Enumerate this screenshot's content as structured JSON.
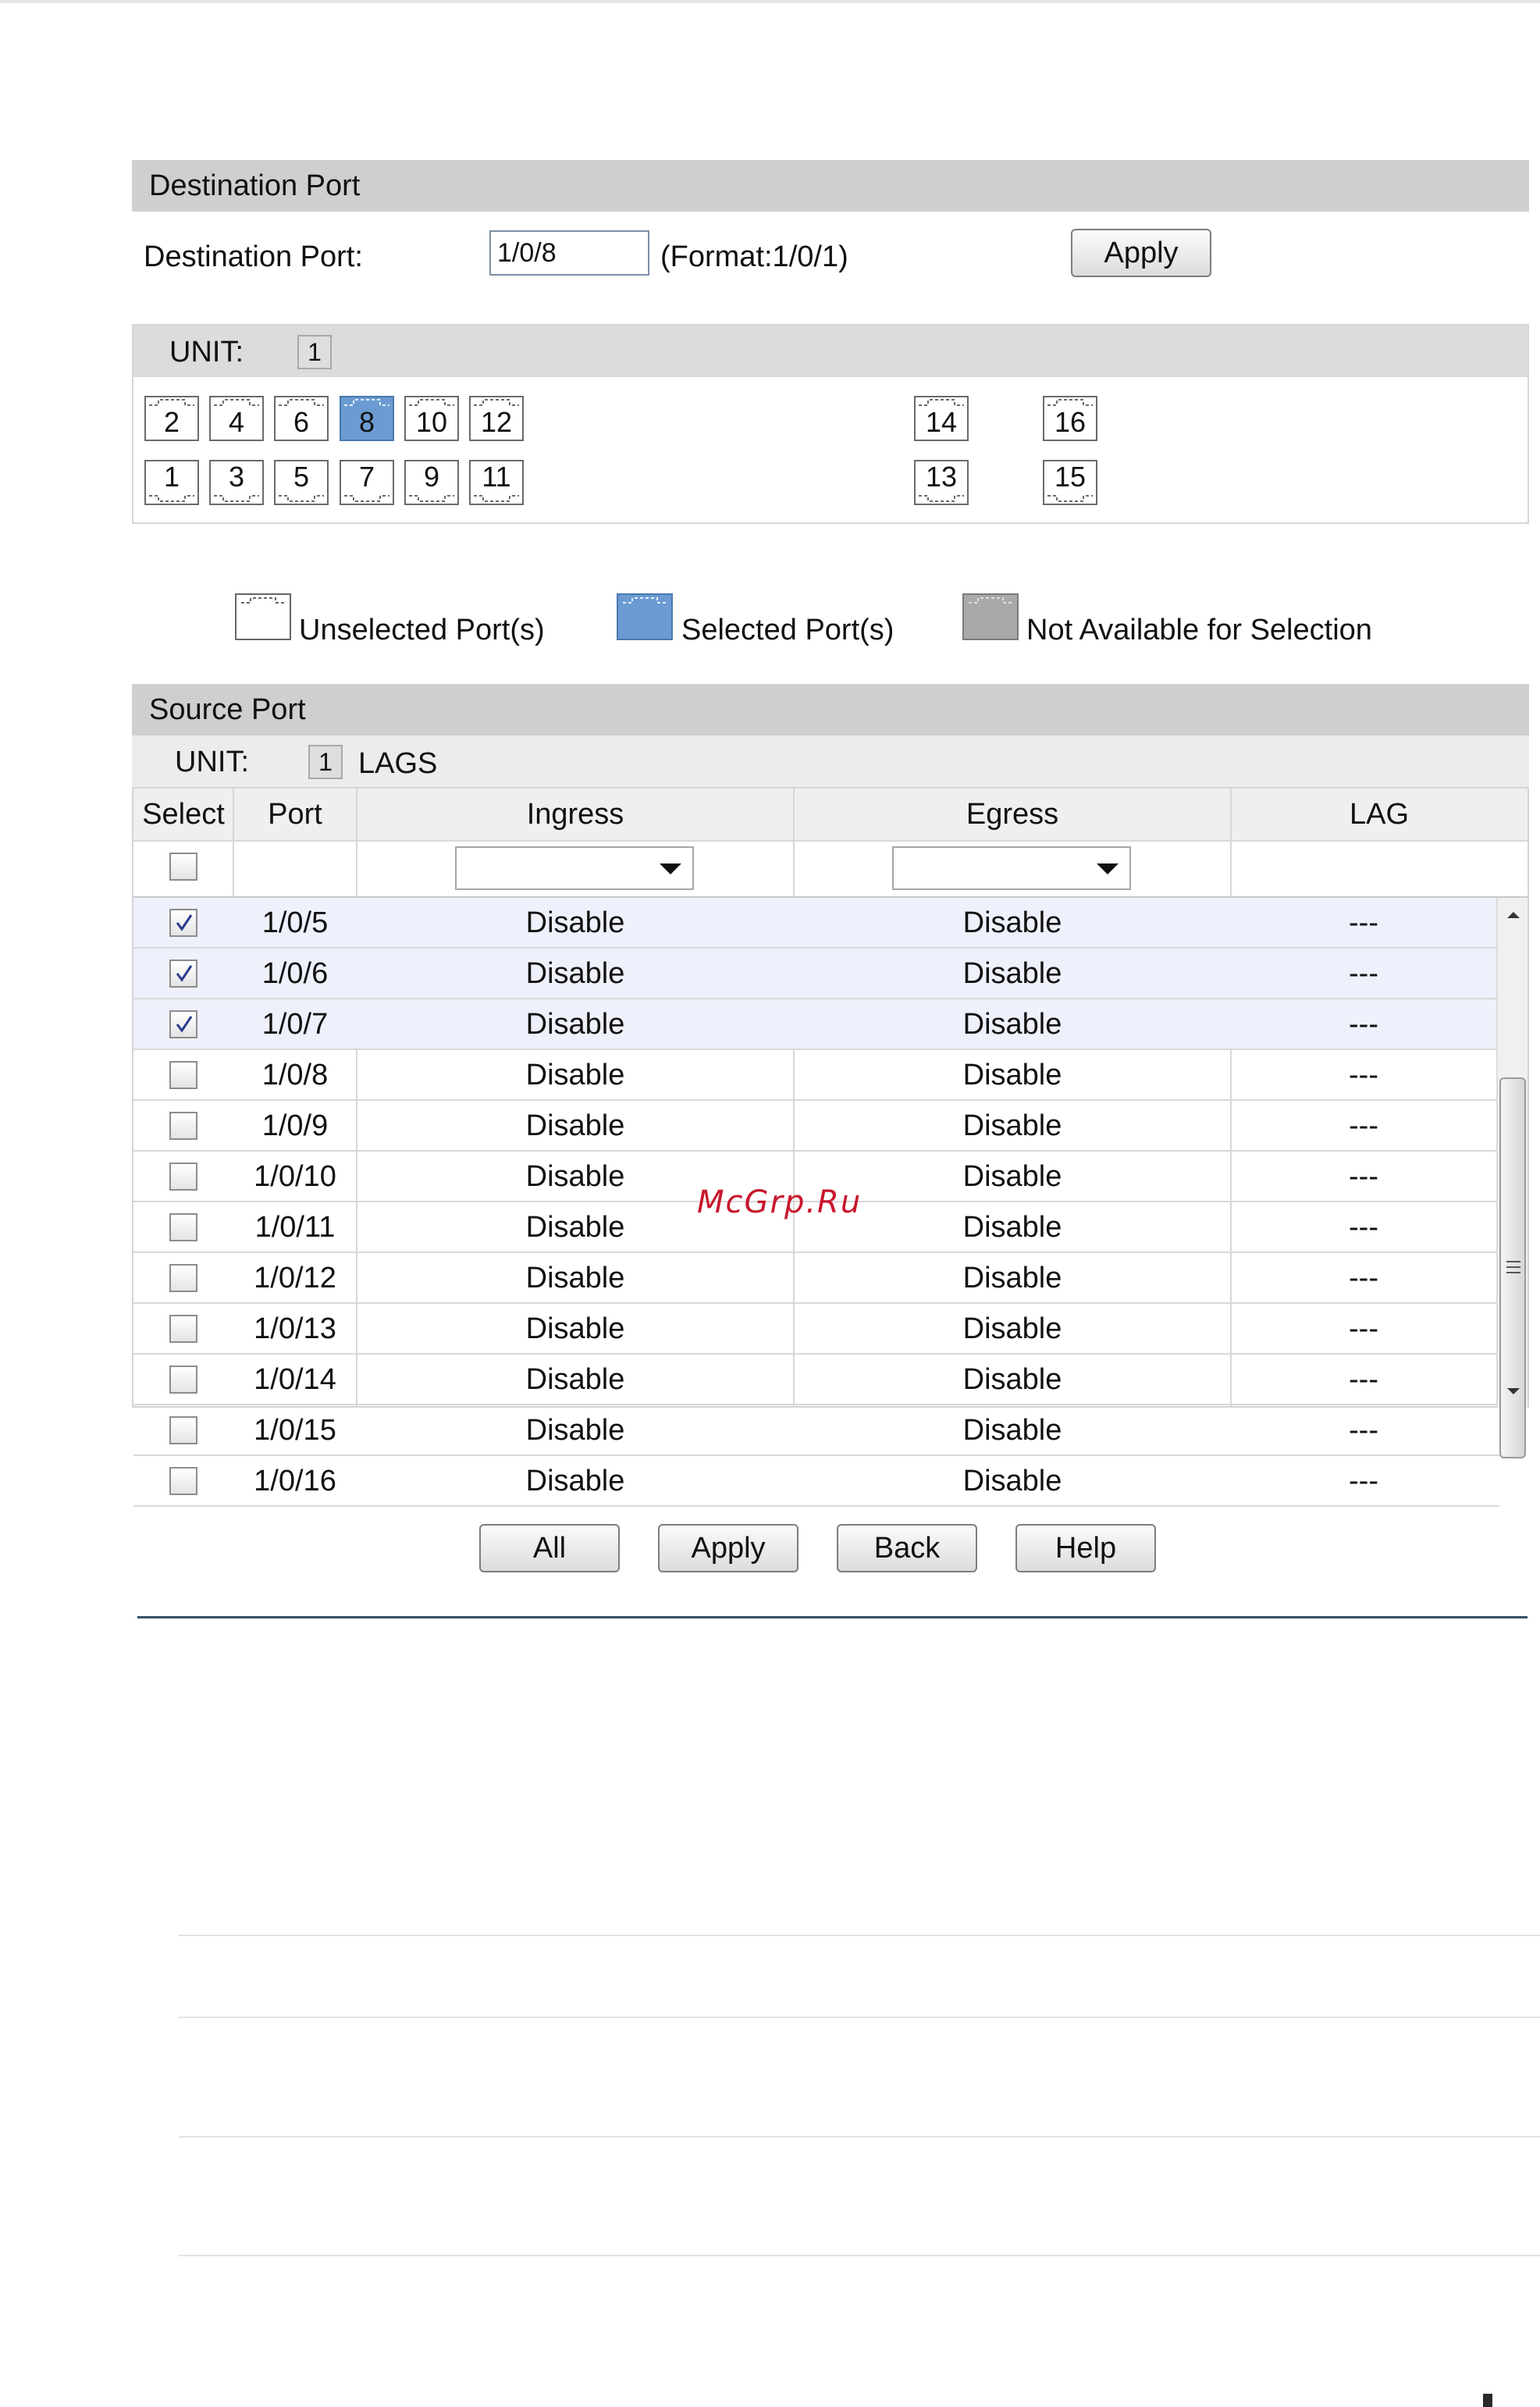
{
  "destination": {
    "section_title": "Destination Port",
    "field_label": "Destination Port:",
    "field_value": "1/0/8",
    "format_hint": "(Format:1/0/1)",
    "apply_label": "Apply",
    "unit_label": "UNIT:",
    "unit_value": "1",
    "ports_top": [
      "2",
      "4",
      "6",
      "8",
      "10",
      "12",
      "14",
      "16"
    ],
    "ports_bottom": [
      "1",
      "3",
      "5",
      "7",
      "9",
      "11",
      "13",
      "15"
    ],
    "selected_port": "8"
  },
  "legend": {
    "unselected": "Unselected Port(s)",
    "selected": "Selected Port(s)",
    "not_available": "Not Available for Selection"
  },
  "source": {
    "section_title": "Source Port",
    "unit_label": "UNIT:",
    "unit_value": "1",
    "lags_label": "LAGS",
    "headers": {
      "select": "Select",
      "port": "Port",
      "ingress": "Ingress",
      "egress": "Egress",
      "lag": "LAG"
    },
    "rows": [
      {
        "port": "1/0/5",
        "ingress": "Disable",
        "egress": "Disable",
        "lag": "---",
        "checked": true
      },
      {
        "port": "1/0/6",
        "ingress": "Disable",
        "egress": "Disable",
        "lag": "---",
        "checked": true
      },
      {
        "port": "1/0/7",
        "ingress": "Disable",
        "egress": "Disable",
        "lag": "---",
        "checked": true
      },
      {
        "port": "1/0/8",
        "ingress": "Disable",
        "egress": "Disable",
        "lag": "---",
        "checked": false
      },
      {
        "port": "1/0/9",
        "ingress": "Disable",
        "egress": "Disable",
        "lag": "---",
        "checked": false
      },
      {
        "port": "1/0/10",
        "ingress": "Disable",
        "egress": "Disable",
        "lag": "---",
        "checked": false
      },
      {
        "port": "1/0/11",
        "ingress": "Disable",
        "egress": "Disable",
        "lag": "---",
        "checked": false
      },
      {
        "port": "1/0/12",
        "ingress": "Disable",
        "egress": "Disable",
        "lag": "---",
        "checked": false
      },
      {
        "port": "1/0/13",
        "ingress": "Disable",
        "egress": "Disable",
        "lag": "---",
        "checked": false
      },
      {
        "port": "1/0/14",
        "ingress": "Disable",
        "egress": "Disable",
        "lag": "---",
        "checked": false
      },
      {
        "port": "1/0/15",
        "ingress": "Disable",
        "egress": "Disable",
        "lag": "---",
        "checked": false
      },
      {
        "port": "1/0/16",
        "ingress": "Disable",
        "egress": "Disable",
        "lag": "---",
        "checked": false
      }
    ]
  },
  "buttons": {
    "all": "All",
    "apply": "Apply",
    "back": "Back",
    "help": "Help"
  },
  "watermark": "McGrp.Ru",
  "colors": {
    "selected_port": "#6b9bd2",
    "header_bar": "#cfcfcf",
    "selected_row": "#eef0fb",
    "rule": "#354f67"
  }
}
